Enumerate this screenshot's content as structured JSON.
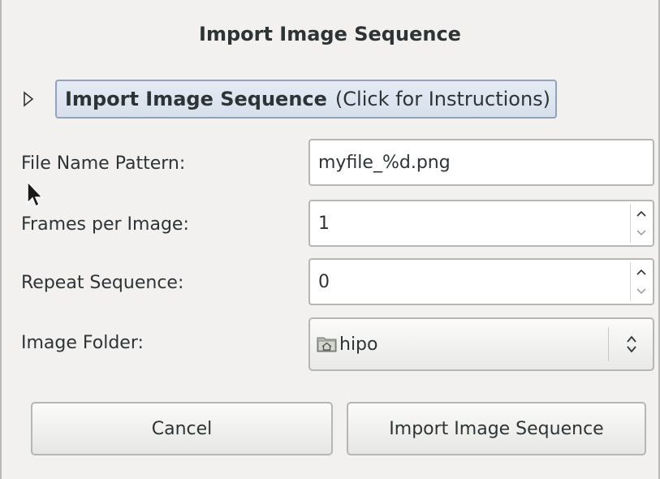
{
  "dialog": {
    "title": "Import Image Sequence"
  },
  "expander": {
    "label_bold": "Import Image Sequence",
    "label_hint": "(Click for Instructions)",
    "icon": "triangle-right-icon"
  },
  "form": {
    "file_name_pattern": {
      "label": "File Name Pattern:",
      "value": "myfile_%d.png"
    },
    "frames_per_image": {
      "label": "Frames per Image:",
      "value": "1"
    },
    "repeat_sequence": {
      "label": "Repeat Sequence:",
      "value": "0"
    },
    "image_folder": {
      "label": "Image Folder:",
      "value": "hipo",
      "icon": "home-folder-icon"
    }
  },
  "buttons": {
    "cancel": "Cancel",
    "import": "Import Image Sequence"
  },
  "colors": {
    "window_bg": "#f2f1f0",
    "expander_bg": "#dde6f0",
    "expander_border": "#8fa3bd",
    "text": "#2e3436"
  }
}
